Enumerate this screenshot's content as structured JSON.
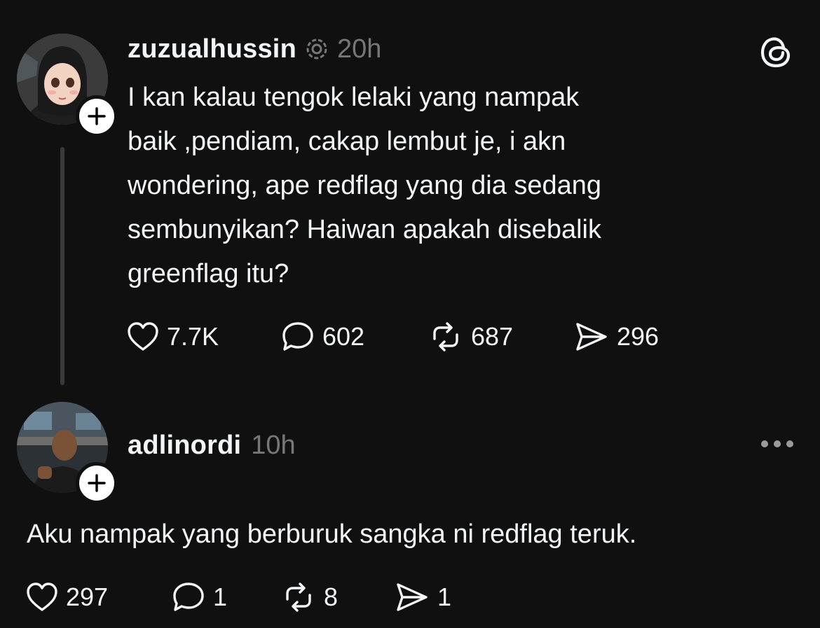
{
  "post": {
    "username": "zuzualhussin",
    "timestamp": "20h",
    "text_lines": [
      "I kan kalau tengok lelaki yang nampak",
      "baik ,pendiam, cakap lembut je, i akn",
      "wondering, ape redflag yang dia sedang",
      "sembunyikan? Haiwan apakah disebalik",
      "greenflag itu?"
    ],
    "likes": "7.7K",
    "replies": "602",
    "reposts": "687",
    "shares": "296"
  },
  "reply": {
    "username": "adlinordi",
    "timestamp": "10h",
    "text": "Aku nampak yang berburuk sangka ni redflag teruk.",
    "likes": "297",
    "replies": "1",
    "reposts": "8",
    "shares": "1"
  },
  "icons": {
    "app_logo": "threads-logo-icon",
    "verified": "verified-ring-icon",
    "like": "heart-icon",
    "reply": "speech-bubble-icon",
    "repost": "repost-icon",
    "share": "send-icon",
    "more": "more-dots-icon",
    "follow": "plus-icon"
  },
  "colors": {
    "background": "#101010",
    "text": "#f3f5f7",
    "muted": "#777777"
  }
}
